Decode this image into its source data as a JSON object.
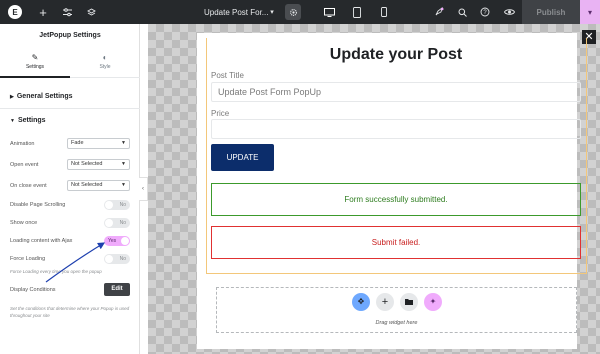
{
  "topbar": {
    "logo": "E",
    "doc_title": "Update Post For...",
    "doc_caret": "▾",
    "publish_label": "Publish",
    "publish_caret": "▾",
    "icons": [
      "elementor-logo-icon",
      "plus-icon",
      "sliders-icon",
      "layers-icon",
      "chevron-down-icon",
      "gear-icon",
      "desktop-icon",
      "tablet-icon",
      "mobile-icon",
      "rocket-icon",
      "search-icon",
      "help-icon",
      "eye-icon"
    ]
  },
  "panel": {
    "title": "JetPopup Settings",
    "tabs": [
      {
        "label": "Settings",
        "icon": "✎"
      },
      {
        "label": "Style",
        "icon": "◐"
      }
    ],
    "general_settings": "General Settings",
    "settings_section": "Settings",
    "rows": {
      "animation": {
        "label": "Animation",
        "value": "Fade"
      },
      "open_event": {
        "label": "Open event",
        "value": "Not Selected"
      },
      "close_event": {
        "label": "On close event",
        "value": "Not Selected"
      },
      "disable_scroll": {
        "label": "Disable Page Scrolling",
        "value": "No"
      },
      "show_once": {
        "label": "Show once",
        "value": "No"
      },
      "ajax": {
        "label": "Loading content with Ajax",
        "value": "Yes"
      },
      "force_loading": {
        "label": "Force Loading",
        "value": "No"
      }
    },
    "force_hint": "Force Loading every time you open the popup",
    "display_conditions": "Display Conditions",
    "edit_label": "Edit",
    "display_hint": "Set the conditions that determine where your Popup is used throughout your site",
    "collapse_arrow": "‹"
  },
  "popup": {
    "close": "✕",
    "title": "Update your Post",
    "post_title_label": "Post Title",
    "post_title_value": "Update Post Form PopUp",
    "price_label": "Price",
    "price_value": "",
    "update_label": "UPDATE",
    "success_msg": "Form successfully submitted.",
    "fail_msg": "Submit failed.",
    "dropzone_text": "Drag widget here",
    "dropzone_buttons": [
      {
        "name": "widget-picker-icon",
        "glyph": "✥",
        "color": "#6ea8fe"
      },
      {
        "name": "add-icon",
        "glyph": "+",
        "color": "#e6e8ea"
      },
      {
        "name": "folder-icon",
        "glyph": "▬",
        "color": "#e6e8ea"
      },
      {
        "name": "ai-sparkle-icon",
        "glyph": "✦",
        "color": "#f0abfc"
      }
    ]
  },
  "colors": {
    "update_button": "#0c2d6b",
    "success_border": "#3c9a2c",
    "fail_border": "#e03131",
    "toggle_on": "#f0abfc",
    "annotation_arrow": "#1e40af"
  }
}
